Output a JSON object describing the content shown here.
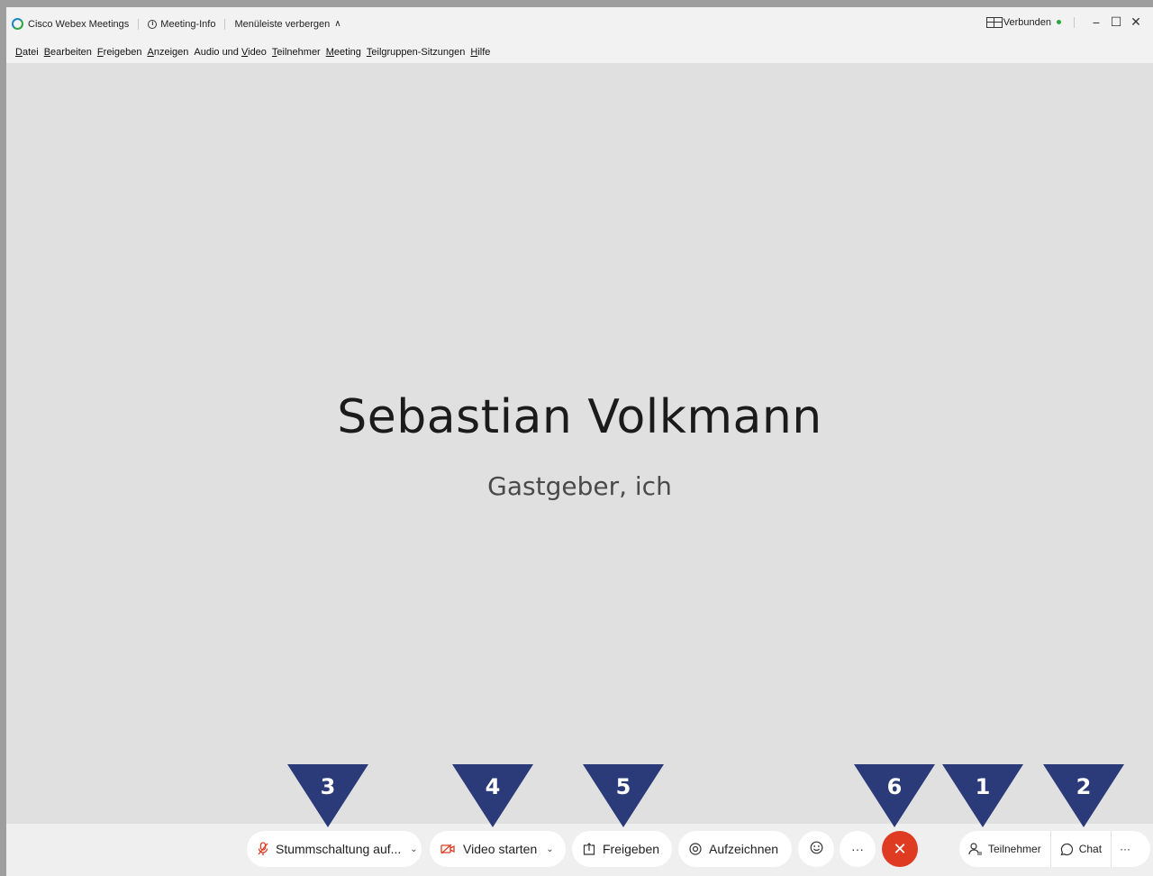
{
  "titlebar": {
    "app_name": "Cisco Webex Meetings",
    "meeting_info": "Meeting-Info",
    "hide_menubar": "Menüleiste verbergen",
    "status": "Verbunden",
    "status_color": "#2ba640"
  },
  "menubar": {
    "items": [
      {
        "ul": "D",
        "rest": "atei"
      },
      {
        "ul": "B",
        "rest": "earbeiten"
      },
      {
        "ul": "F",
        "rest": "reigeben"
      },
      {
        "ul": "A",
        "rest": "nzeigen"
      },
      {
        "pre": "Audio und ",
        "ul": "V",
        "rest": "ideo"
      },
      {
        "ul": "T",
        "rest": "eilnehmer"
      },
      {
        "ul": "M",
        "rest": "eeting"
      },
      {
        "ul": "T",
        "rest": "eilgruppen-Sitzungen"
      },
      {
        "ul": "H",
        "rest": "ilfe"
      }
    ]
  },
  "stage": {
    "participant_name": "Sebastian Volkmann",
    "participant_role": "Gastgeber, ich"
  },
  "controls": {
    "mute_label": "Stummschaltung auf...",
    "video_label": "Video starten",
    "share_label": "Freigeben",
    "record_label": "Aufzeichnen",
    "more_label": "···",
    "end_label": "✕",
    "participants_label": "Teilnehmer",
    "chat_label": "Chat",
    "right_more_label": "···",
    "accent_red": "#df3a22"
  },
  "markers": {
    "color": "#2b3a78",
    "labels": {
      "mute": "3",
      "video": "4",
      "share": "5",
      "end": "6",
      "participants": "1",
      "chat": "2"
    }
  }
}
